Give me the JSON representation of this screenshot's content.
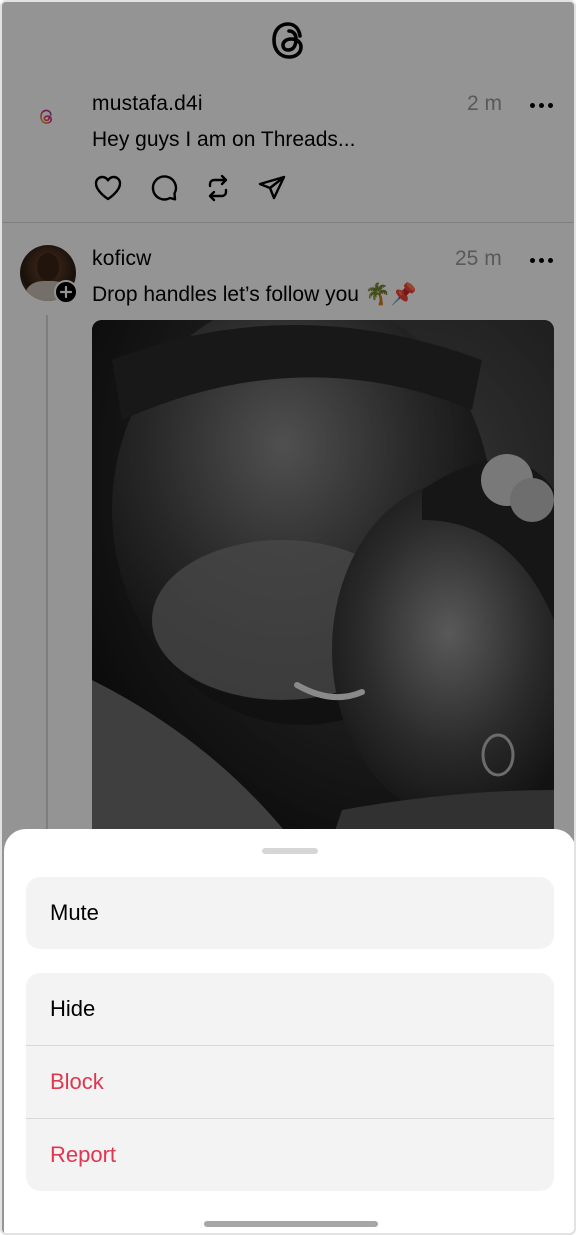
{
  "app": {
    "logo_icon": "threads-logo-icon"
  },
  "posts": [
    {
      "username": "mustafa.d4i",
      "time": "2 m",
      "text": "Hey guys I am on Threads...",
      "actions": [
        "heart-icon",
        "comment-icon",
        "repost-icon",
        "share-icon"
      ]
    },
    {
      "username": "koficw",
      "time": "25 m",
      "text": "Drop handles let’s follow you 🌴📌",
      "image": "grandfather-and-girl-photo"
    }
  ],
  "sheet": {
    "group1": [
      {
        "label": "Mute",
        "color": "#000000"
      }
    ],
    "group2": [
      {
        "label": "Hide",
        "color": "#000000"
      },
      {
        "label": "Block",
        "color": "#e0364f"
      },
      {
        "label": "Report",
        "color": "#e0364f"
      }
    ]
  }
}
